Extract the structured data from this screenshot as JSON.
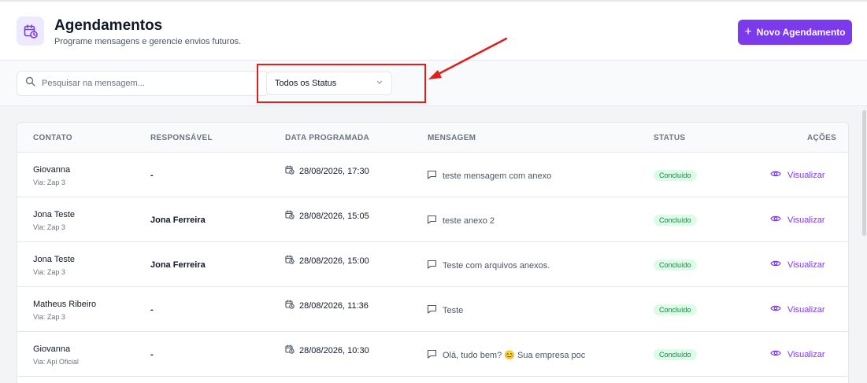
{
  "header": {
    "title": "Agendamentos",
    "subtitle": "Programe mensagens e gerencie envios futuros.",
    "new_button_label": "Novo Agendamento",
    "logo_icon": "calendar-clock-icon"
  },
  "filters": {
    "search_placeholder": "Pesquisar na mensagem...",
    "search_value": "",
    "status_selected": "Todos os Status"
  },
  "colors": {
    "accent": "#7c3aed",
    "success_bg": "#dcfce7",
    "success_text": "#15803d",
    "annotation": "#e11d1d"
  },
  "table": {
    "columns": {
      "contato": "CONTATO",
      "responsavel": "RESPONSÁVEL",
      "data": "DATA PROGRAMADA",
      "mensagem": "MENSAGEM",
      "status": "STATUS",
      "acoes": "AÇÕES"
    },
    "rows": [
      {
        "contact": "Giovanna",
        "via": "Via: Zap 3",
        "responsible": "-",
        "date": "28/08/2026, 17:30",
        "message": "teste mensagem com anexo",
        "status": "Concluído",
        "action": "Visualizar"
      },
      {
        "contact": "Jona Teste",
        "via": "Via: Zap 3",
        "responsible": "Jona Ferreira",
        "date": "28/08/2026, 15:05",
        "message": "teste anexo 2",
        "status": "Concluído",
        "action": "Visualizar"
      },
      {
        "contact": "Jona Teste",
        "via": "Via: Zap 3",
        "responsible": "Jona Ferreira",
        "date": "28/08/2026, 15:00",
        "message": "Teste com arquivos anexos.",
        "status": "Concluído",
        "action": "Visualizar"
      },
      {
        "contact": "Matheus Ribeiro",
        "via": "Via: Zap 3",
        "responsible": "-",
        "date": "28/08/2026, 11:36",
        "message": "Teste",
        "status": "Concluído",
        "action": "Visualizar"
      },
      {
        "contact": "Giovanna",
        "via": "Via: Api Oficial",
        "responsible": "-",
        "date": "28/08/2026, 10:30",
        "message": "Olá, tudo bem? 😊 Sua empresa poc",
        "status": "Concluído",
        "action": "Visualizar"
      }
    ]
  }
}
